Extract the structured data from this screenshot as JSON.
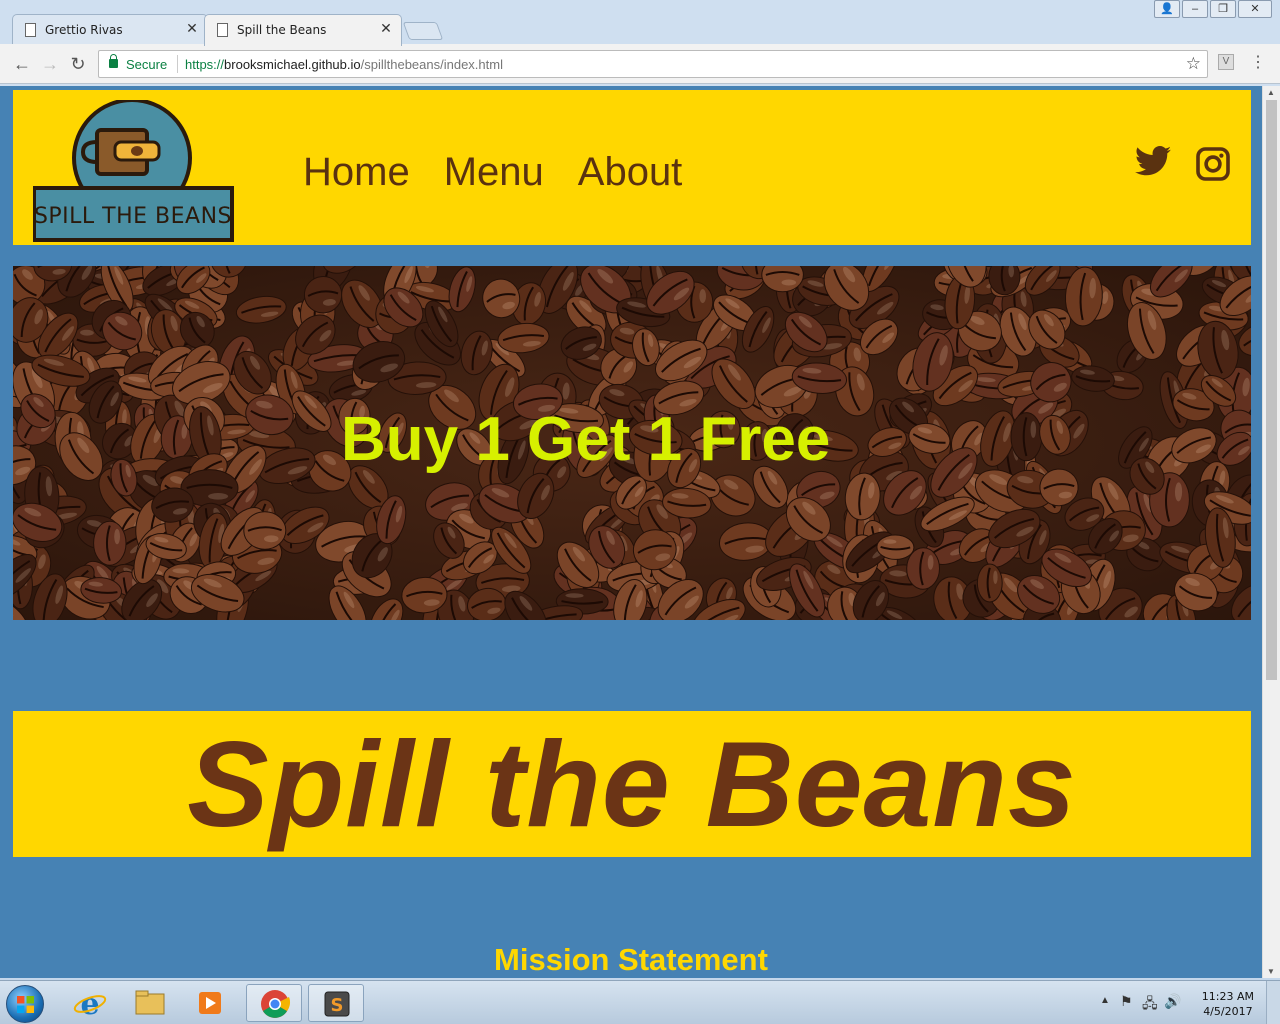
{
  "browser": {
    "tabs": [
      {
        "title": "Grettio Rivas",
        "active": false
      },
      {
        "title": "Spill the Beans",
        "active": true
      }
    ],
    "secure_label": "Secure",
    "url": {
      "scheme": "https://",
      "host": "brooksmichael.github.io",
      "path": "/spillthebeans/index.html"
    },
    "extension_label": "V"
  },
  "site": {
    "logo_text": "SPILL THE BEANS",
    "nav": [
      "Home",
      "Menu",
      "About"
    ],
    "social": [
      "twitter-icon",
      "instagram-icon"
    ],
    "hero_text": "Buy 1 Get 1 Free",
    "banner_title": "Spill the Beans",
    "mission_heading": "Mission Statement",
    "colors": {
      "header_bg": "#ffd700",
      "page_bg": "#4682b4",
      "nav_text": "#5a3210",
      "hero_text": "#d7f000",
      "banner_text": "#6b3416",
      "mission_text": "#ffd700"
    }
  },
  "taskbar": {
    "apps": [
      "internet-explorer-icon",
      "file-explorer-icon",
      "media-player-icon",
      "chrome-icon",
      "sublime-text-icon"
    ],
    "clock_time": "11:23 AM",
    "clock_date": "4/5/2017"
  }
}
